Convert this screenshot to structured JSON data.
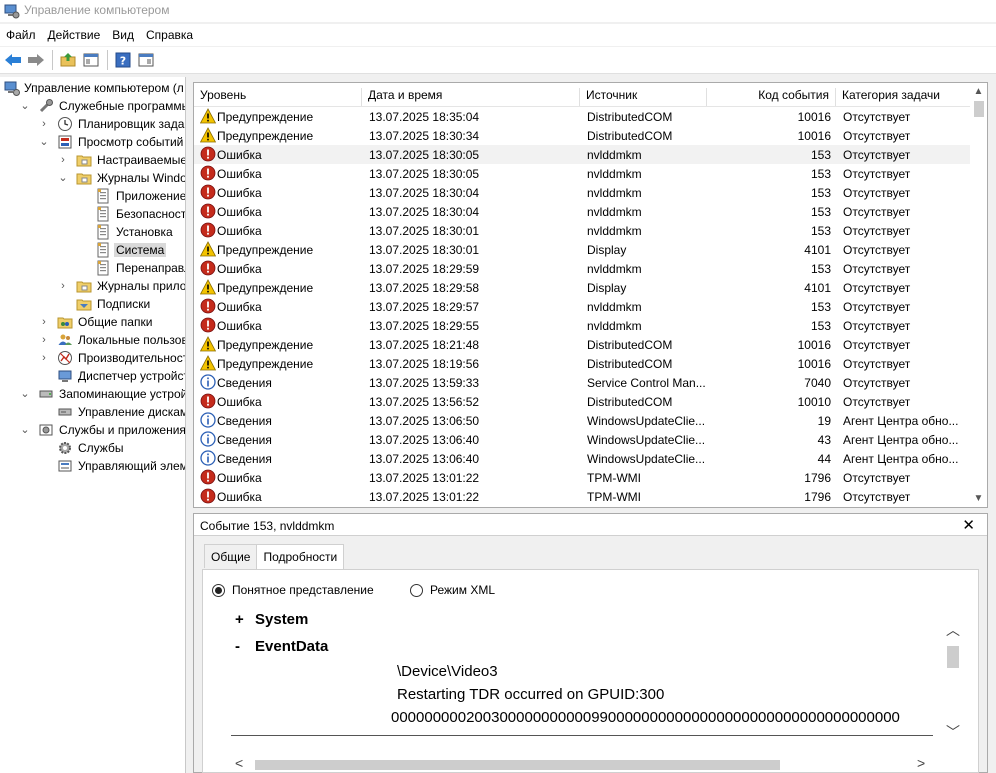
{
  "window": {
    "title": "Управление компьютером"
  },
  "menu": [
    "Файл",
    "Действие",
    "Вид",
    "Справка"
  ],
  "tree": [
    {
      "label": "Управление компьютером (л",
      "indent": 0,
      "twisty": "",
      "icon": "computer-management-icon"
    },
    {
      "label": "Служебные программы",
      "indent": 1,
      "twisty": "v",
      "icon": "tools-icon"
    },
    {
      "label": "Планировщик заданий",
      "indent": 2,
      "twisty": ">",
      "icon": "clock-icon"
    },
    {
      "label": "Просмотр событий",
      "indent": 2,
      "twisty": "v",
      "icon": "event-viewer-icon"
    },
    {
      "label": "Настраиваемые пр",
      "indent": 3,
      "twisty": ">",
      "icon": "folder-icon"
    },
    {
      "label": "Журналы Windows",
      "indent": 3,
      "twisty": "v",
      "icon": "folder-icon"
    },
    {
      "label": "Приложение",
      "indent": 4,
      "twisty": "",
      "icon": "log-icon"
    },
    {
      "label": "Безопасность",
      "indent": 4,
      "twisty": "",
      "icon": "log-icon"
    },
    {
      "label": "Установка",
      "indent": 4,
      "twisty": "",
      "icon": "log-icon"
    },
    {
      "label": "Система",
      "indent": 4,
      "twisty": "",
      "icon": "log-icon",
      "selected": true
    },
    {
      "label": "Перенаправлен",
      "indent": 4,
      "twisty": "",
      "icon": "log-icon"
    },
    {
      "label": "Журналы приложе",
      "indent": 3,
      "twisty": ">",
      "icon": "folder-icon"
    },
    {
      "label": "Подписки",
      "indent": 3,
      "twisty": "",
      "icon": "subscriptions-icon"
    },
    {
      "label": "Общие папки",
      "indent": 2,
      "twisty": ">",
      "icon": "shared-folders-icon"
    },
    {
      "label": "Локальные пользовате",
      "indent": 2,
      "twisty": ">",
      "icon": "users-icon"
    },
    {
      "label": "Производительность",
      "indent": 2,
      "twisty": ">",
      "icon": "performance-icon"
    },
    {
      "label": "Диспетчер устройств",
      "indent": 2,
      "twisty": "",
      "icon": "device-manager-icon"
    },
    {
      "label": "Запоминающие устройст",
      "indent": 1,
      "twisty": "v",
      "icon": "storage-icon"
    },
    {
      "label": "Управление дисками",
      "indent": 2,
      "twisty": "",
      "icon": "disk-icon"
    },
    {
      "label": "Службы и приложения",
      "indent": 1,
      "twisty": "v",
      "icon": "services-apps-icon"
    },
    {
      "label": "Службы",
      "indent": 2,
      "twisty": "",
      "icon": "gear-icon"
    },
    {
      "label": "Управляющий элемен",
      "indent": 2,
      "twisty": "",
      "icon": "wmi-icon"
    }
  ],
  "grid": {
    "columns": [
      "Уровень",
      "Дата и время",
      "Источник",
      "Код события",
      "Категория задачи"
    ],
    "rows": [
      {
        "level": "warning",
        "level_text": "Предупреждение",
        "date": "13.07.2025 18:35:04",
        "source": "DistributedCOM",
        "code": "10016",
        "category": "Отсутствует"
      },
      {
        "level": "warning",
        "level_text": "Предупреждение",
        "date": "13.07.2025 18:30:34",
        "source": "DistributedCOM",
        "code": "10016",
        "category": "Отсутствует"
      },
      {
        "level": "error",
        "level_text": "Ошибка",
        "date": "13.07.2025 18:30:05",
        "source": "nvlddmkm",
        "code": "153",
        "category": "Отсутствует",
        "selected": true
      },
      {
        "level": "error",
        "level_text": "Ошибка",
        "date": "13.07.2025 18:30:05",
        "source": "nvlddmkm",
        "code": "153",
        "category": "Отсутствует"
      },
      {
        "level": "error",
        "level_text": "Ошибка",
        "date": "13.07.2025 18:30:04",
        "source": "nvlddmkm",
        "code": "153",
        "category": "Отсутствует"
      },
      {
        "level": "error",
        "level_text": "Ошибка",
        "date": "13.07.2025 18:30:04",
        "source": "nvlddmkm",
        "code": "153",
        "category": "Отсутствует"
      },
      {
        "level": "error",
        "level_text": "Ошибка",
        "date": "13.07.2025 18:30:01",
        "source": "nvlddmkm",
        "code": "153",
        "category": "Отсутствует"
      },
      {
        "level": "warning",
        "level_text": "Предупреждение",
        "date": "13.07.2025 18:30:01",
        "source": "Display",
        "code": "4101",
        "category": "Отсутствует"
      },
      {
        "level": "error",
        "level_text": "Ошибка",
        "date": "13.07.2025 18:29:59",
        "source": "nvlddmkm",
        "code": "153",
        "category": "Отсутствует"
      },
      {
        "level": "warning",
        "level_text": "Предупреждение",
        "date": "13.07.2025 18:29:58",
        "source": "Display",
        "code": "4101",
        "category": "Отсутствует"
      },
      {
        "level": "error",
        "level_text": "Ошибка",
        "date": "13.07.2025 18:29:57",
        "source": "nvlddmkm",
        "code": "153",
        "category": "Отсутствует"
      },
      {
        "level": "error",
        "level_text": "Ошибка",
        "date": "13.07.2025 18:29:55",
        "source": "nvlddmkm",
        "code": "153",
        "category": "Отсутствует"
      },
      {
        "level": "warning",
        "level_text": "Предупреждение",
        "date": "13.07.2025 18:21:48",
        "source": "DistributedCOM",
        "code": "10016",
        "category": "Отсутствует"
      },
      {
        "level": "warning",
        "level_text": "Предупреждение",
        "date": "13.07.2025 18:19:56",
        "source": "DistributedCOM",
        "code": "10016",
        "category": "Отсутствует"
      },
      {
        "level": "info",
        "level_text": "Сведения",
        "date": "13.07.2025 13:59:33",
        "source": "Service Control Man...",
        "code": "7040",
        "category": "Отсутствует"
      },
      {
        "level": "error",
        "level_text": "Ошибка",
        "date": "13.07.2025 13:56:52",
        "source": "DistributedCOM",
        "code": "10010",
        "category": "Отсутствует"
      },
      {
        "level": "info",
        "level_text": "Сведения",
        "date": "13.07.2025 13:06:50",
        "source": "WindowsUpdateClie...",
        "code": "19",
        "category": "Агент Центра обно..."
      },
      {
        "level": "info",
        "level_text": "Сведения",
        "date": "13.07.2025 13:06:40",
        "source": "WindowsUpdateClie...",
        "code": "43",
        "category": "Агент Центра обно..."
      },
      {
        "level": "info",
        "level_text": "Сведения",
        "date": "13.07.2025 13:06:40",
        "source": "WindowsUpdateClie...",
        "code": "44",
        "category": "Агент Центра обно..."
      },
      {
        "level": "error",
        "level_text": "Ошибка",
        "date": "13.07.2025 13:01:22",
        "source": "TPM-WMI",
        "code": "1796",
        "category": "Отсутствует"
      },
      {
        "level": "error",
        "level_text": "Ошибка",
        "date": "13.07.2025 13:01:22",
        "source": "TPM-WMI",
        "code": "1796",
        "category": "Отсутствует"
      }
    ]
  },
  "details": {
    "title": "Событие 153, nvlddmkm",
    "close": "✕",
    "tabs": [
      "Общие",
      "Подробности"
    ],
    "radio_friendly": "Понятное представление",
    "radio_xml": "Режим XML",
    "node_system": "System",
    "node_eventdata": "EventData",
    "sign_plus": "+",
    "sign_minus": "-",
    "values": [
      "\\Device\\Video3",
      "Restarting TDR occurred on GPUID:300",
      "0000000002003000000000009900000000000000000000000000000000000"
    ]
  },
  "colors": {
    "error": "#c42b1c",
    "warning": "#f3c300",
    "info": "#2b5fb5",
    "selection": "#d9d9d9"
  }
}
